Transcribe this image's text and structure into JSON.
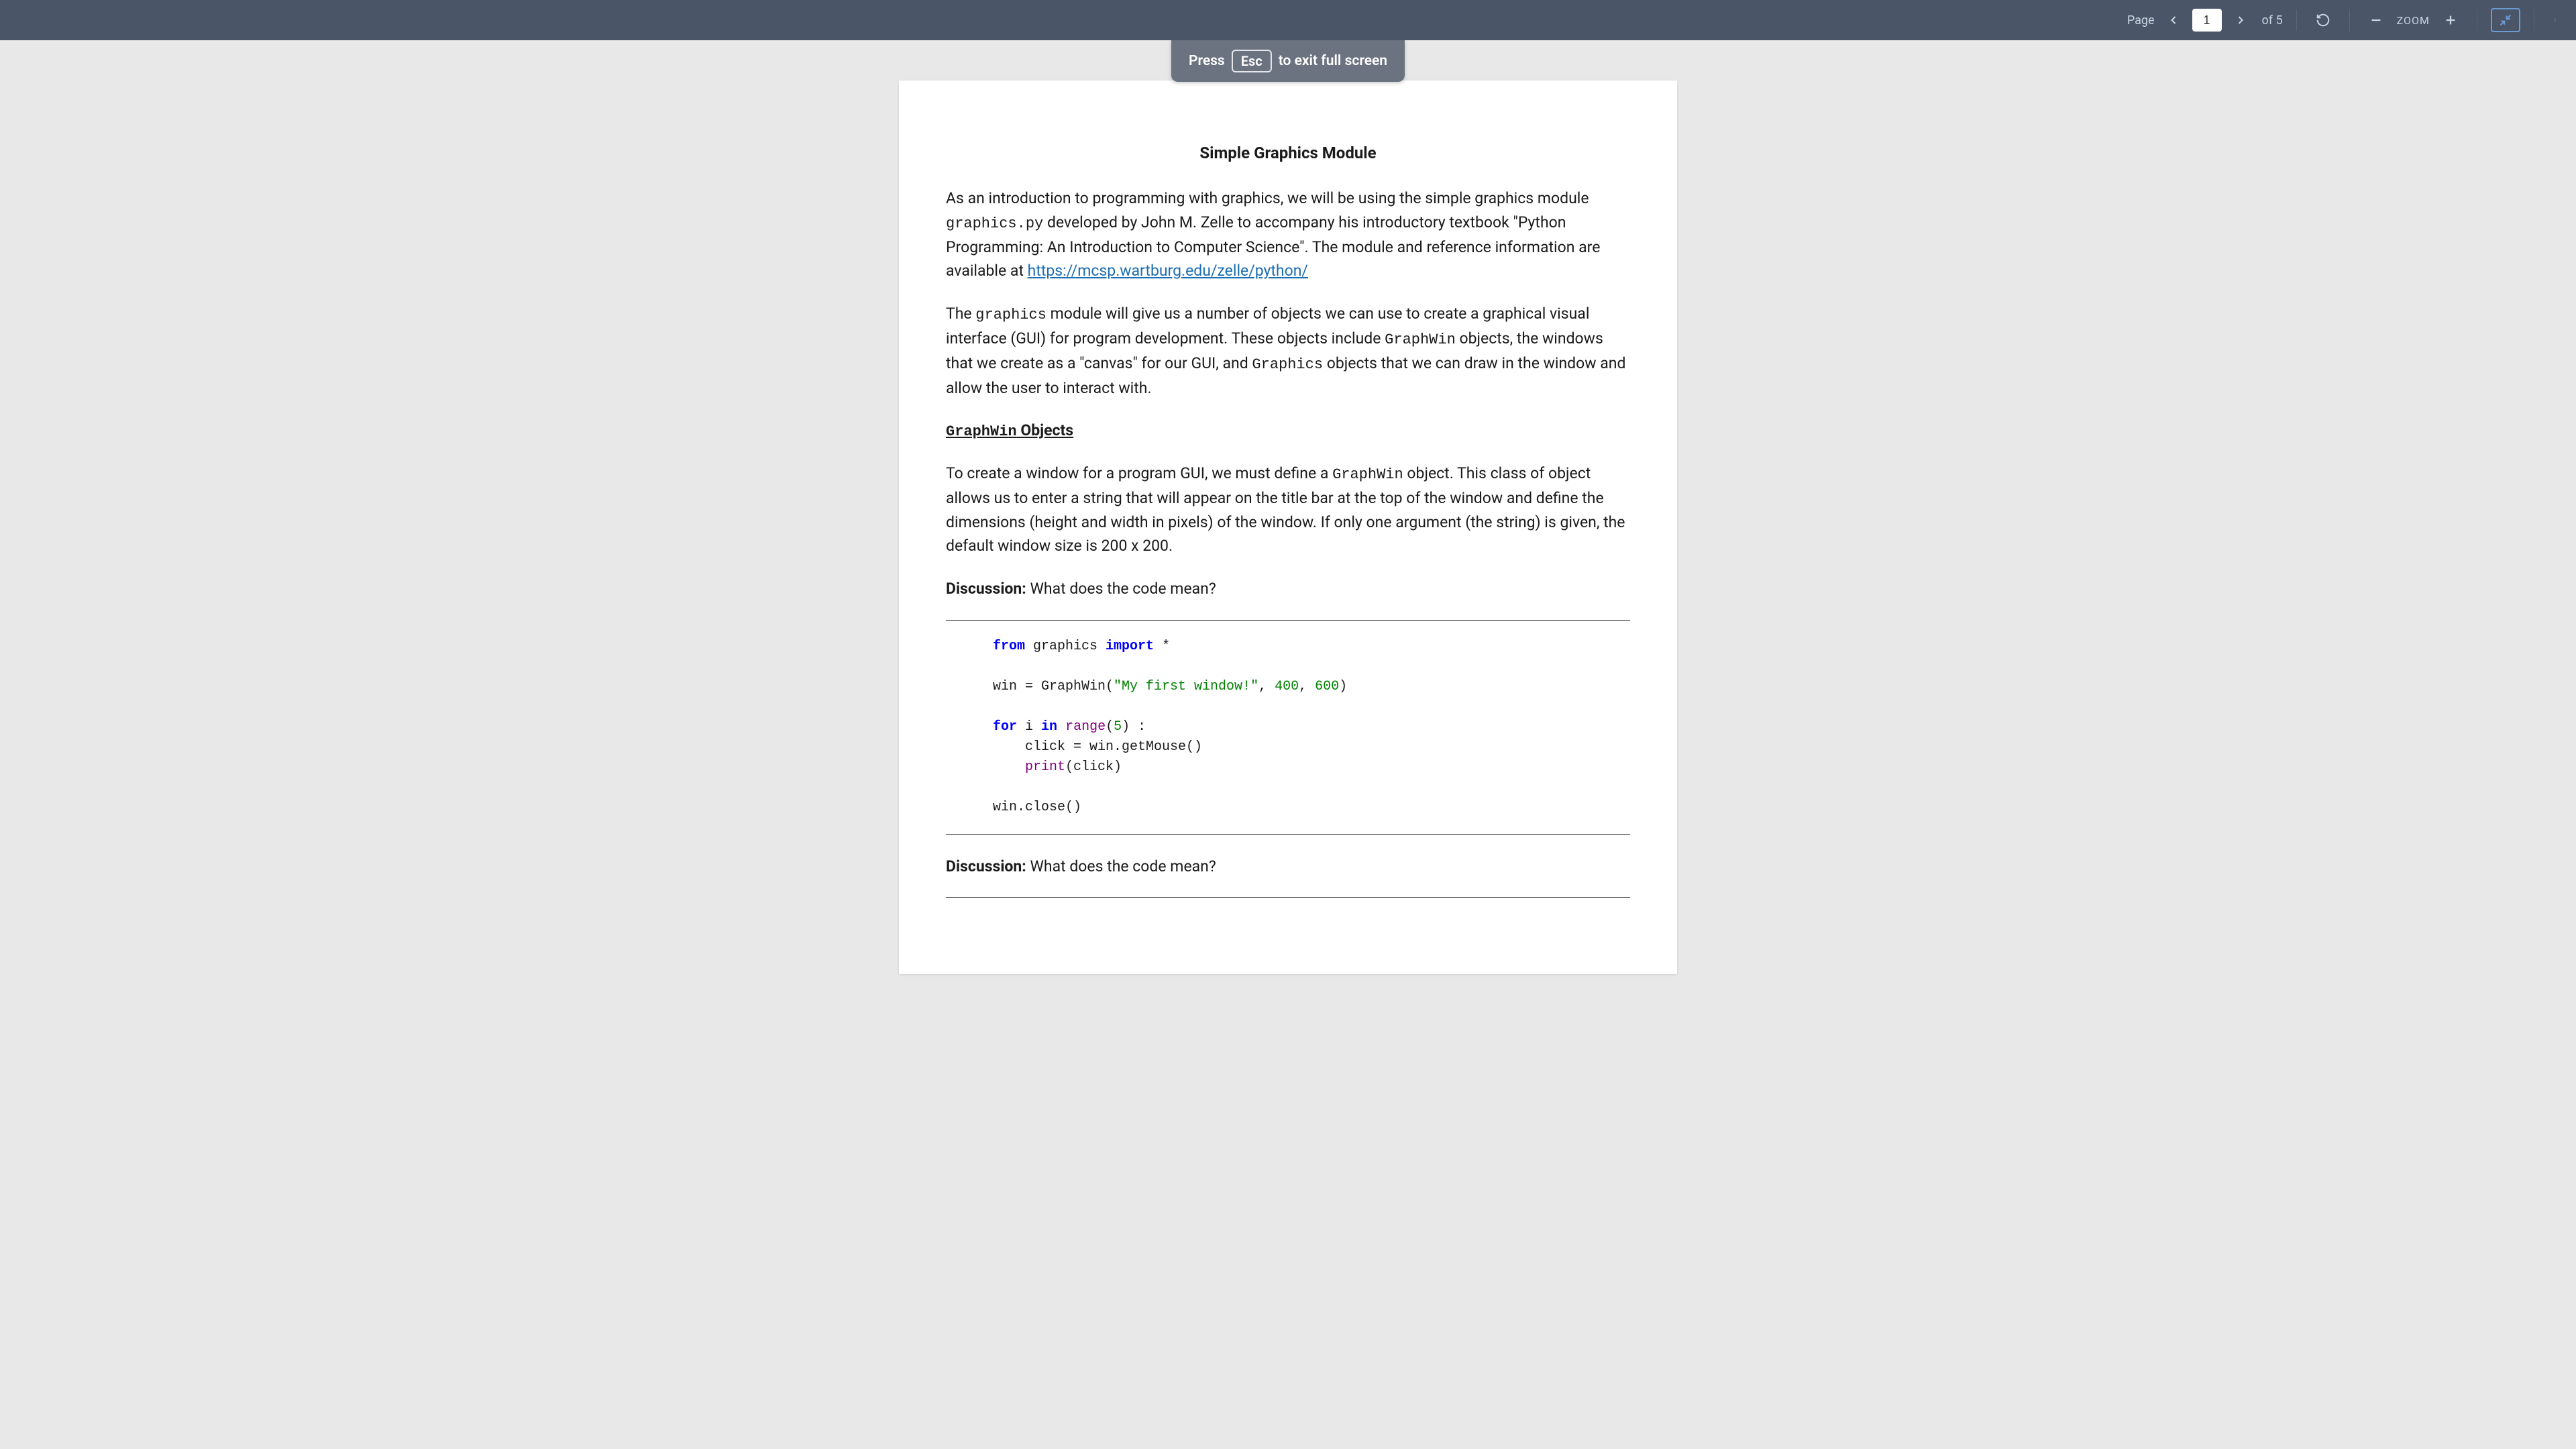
{
  "toolbar": {
    "page_label": "Page",
    "current_page": "1",
    "total_label": "of 5",
    "zoom_label": "ZOOM"
  },
  "esc_hint": {
    "prefix": "Press",
    "key": "Esc",
    "suffix": "to exit full screen"
  },
  "document": {
    "title": "Simple Graphics Module",
    "p1_a": "As an introduction to programming with graphics, we will be using the simple graphics module ",
    "p1_code": "graphics.py",
    "p1_b": " developed by John M. Zelle to accompany his introductory textbook \"Python Programming: An Introduction to Computer Science\". The module and reference information are available at ",
    "p1_link": "https://mcsp.wartburg.edu/zelle/python/",
    "p2_a": "The ",
    "p2_code1": "graphics",
    "p2_b": " module will give us a number of objects we can use to create a graphical visual interface (GUI) for program development. These objects include ",
    "p2_code2": "GraphWin",
    "p2_c": " objects, the windows that we create as a \"canvas\" for our GUI, and ",
    "p2_code3": "Graphics",
    "p2_d": " objects that we can draw in the window and allow the user to interact with.",
    "section_heading_code": "GraphWin",
    "section_heading_text": " Objects",
    "p3_a": "To create a window for a program GUI, we must define a ",
    "p3_code": "GraphWin",
    "p3_b": " object. This class of object allows us to enter a string that will appear on the title bar at the top of the window and define the dimensions (height and width in pixels) of the window. If only one argument (the string) is given, the default window size is 200 x 200.",
    "discussion_label": "Discussion:",
    "discussion_q": " What does the code mean?",
    "code": {
      "l1_kw1": "from",
      "l1_mod": " graphics ",
      "l1_kw2": "import",
      "l1_star": " *",
      "l2_a": "win = GraphWin(",
      "l2_str": "\"My first window!\"",
      "l2_b": ", ",
      "l2_n1": "400",
      "l2_c": ", ",
      "l2_n2": "600",
      "l2_d": ")",
      "l3_kw1": "for",
      "l3_a": " i ",
      "l3_kw2": "in",
      "l3_b": " ",
      "l3_builtin": "range",
      "l3_c": "(",
      "l3_n": "5",
      "l3_d": ") :",
      "l4": "    click = win.getMouse()",
      "l5_a": "    ",
      "l5_builtin": "print",
      "l5_b": "(click)",
      "l6": "win.close()"
    }
  }
}
